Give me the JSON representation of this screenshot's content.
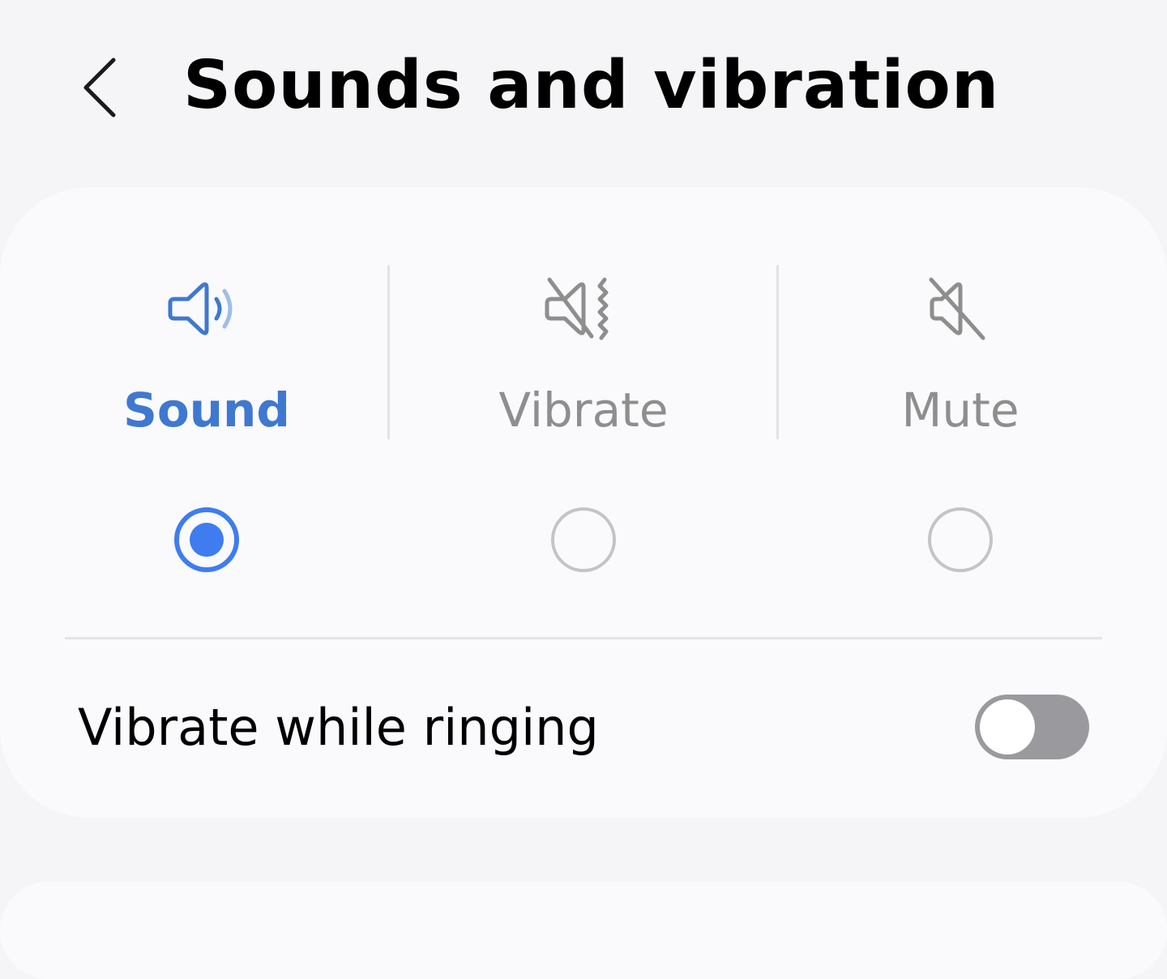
{
  "header": {
    "title": "Sounds and vibration",
    "back_icon": "chevron-left-icon"
  },
  "sound_mode": {
    "selected": "sound",
    "options": [
      {
        "id": "sound",
        "label": "Sound",
        "icon": "speaker-sound-icon",
        "selected": true
      },
      {
        "id": "vibrate",
        "label": "Vibrate",
        "icon": "speaker-vibrate-icon",
        "selected": false
      },
      {
        "id": "mute",
        "label": "Mute",
        "icon": "speaker-mute-icon",
        "selected": false
      }
    ]
  },
  "vibrate_while_ringing": {
    "label": "Vibrate while ringing",
    "enabled": false
  },
  "colors": {
    "accent": "#3e7cf0",
    "selected_label": "#3f78d0",
    "inactive": "#8e8e8e",
    "background": "#f5f5f7",
    "card": "#fafafc",
    "toggle_off": "#9a9a9e"
  }
}
